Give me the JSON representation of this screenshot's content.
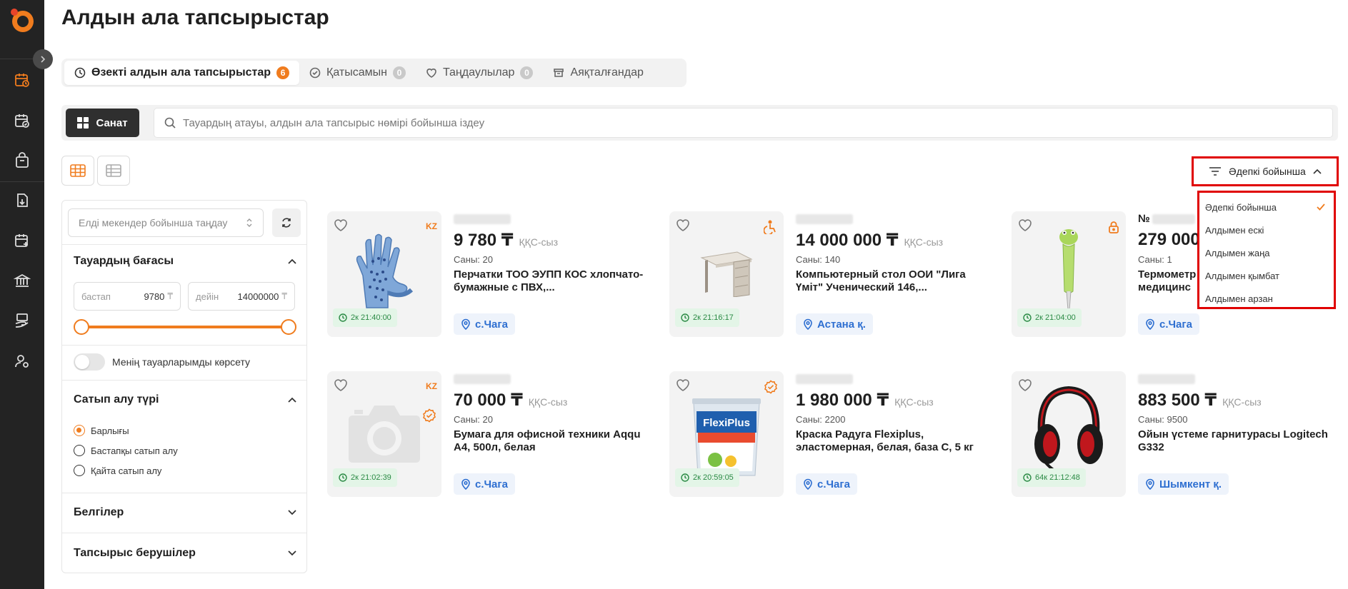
{
  "colors": {
    "accent": "#f07c1e",
    "sidebar": "#232323",
    "highlight": "#e00000",
    "timer_bg": "#e3f5e7",
    "location": "#2e6fd1"
  },
  "sidebar": {
    "icons": [
      "calendar-clock-icon",
      "calendar-check-icon",
      "shopping-bag-icon",
      "document-download-icon",
      "calendar-plus-icon",
      "bank-icon",
      "hand-cash-icon",
      "user-settings-icon"
    ]
  },
  "header": {
    "title": "Алдын ала тапсырыстар"
  },
  "tabs": [
    {
      "label": "Өзекті алдын ала тапсырыстар",
      "count": "6",
      "icon": "clock-icon"
    },
    {
      "label": "Қатысамын",
      "count": "0",
      "icon": "check-circle-icon"
    },
    {
      "label": "Таңдаулылар",
      "count": "0",
      "icon": "heart-icon"
    },
    {
      "label": "Аяқталғандар",
      "icon": "archive-icon"
    }
  ],
  "search": {
    "category_label": "Санат",
    "placeholder": "Тауардың атауы, алдын ала тапсырыс нөмірі бойынша іздеу"
  },
  "sort": {
    "selected": "Әдепкі бойынша",
    "options": [
      "Әдепкі бойынша",
      "Алдымен ескі",
      "Алдымен жаңа",
      "Алдымен қымбат",
      "Алдымен арзан"
    ]
  },
  "filters": {
    "location_placeholder": "Елді мекендер бойынша таңдау",
    "price": {
      "title": "Тауардың бағасы",
      "from_label": "бастап",
      "from_value": "9780",
      "to_label": "дейін",
      "to_value": "14000000",
      "currency": "₸"
    },
    "my_goods_label": "Менің тауарларымды көрсету",
    "purchase_type": {
      "title": "Сатып алу түрі",
      "options": [
        "Барлығы",
        "Бастапқы сатып алу",
        "Қайта сатып алу"
      ],
      "selected": 0
    },
    "tags_title": "Белгілер",
    "customers_title": "Тапсырыс берушілер"
  },
  "products": [
    {
      "id_prefix": "",
      "price": "9 780 ₸",
      "vat": "ҚҚС-сыз",
      "qty": "Саны: 20",
      "title": "Перчатки ТОО ЭУПП КОС хлопчато-бумажные с ПВХ,...",
      "timer": "2к 21:40:00",
      "location": "с.Чага",
      "badge": "KZ",
      "image": "gloves"
    },
    {
      "id_prefix": "",
      "price": "14 000 000 ₸",
      "vat": "ҚҚС-сыз",
      "qty": "Саны: 140",
      "title": "Компьютерный стол ООИ \"Лига Үміт\" Ученический 146,...",
      "timer": "2к 21:16:17",
      "location": "Астана қ.",
      "badge": "accessibility",
      "image": "desk"
    },
    {
      "id_prefix": "№",
      "price": "279 000",
      "vat": "",
      "qty": "Саны: 1",
      "title": "Термометр медицинс",
      "timer": "2к 21:04:00",
      "location": "с.Чага",
      "badge": "lock",
      "image": "thermometer"
    },
    {
      "id_prefix": "",
      "price": "70 000 ₸",
      "vat": "ҚҚС-сыз",
      "qty": "Саны: 20",
      "title": "Бумага для офисной техники Aqqu A4, 500л, белая",
      "timer": "2к 21:02:39",
      "location": "с.Чага",
      "badge": "KZ",
      "image": "camera"
    },
    {
      "id_prefix": "",
      "price": "1 980 000 ₸",
      "vat": "ҚҚС-сыз",
      "qty": "Саны: 2200",
      "title": "Краска Радуга Flexiplus, эластомерная, белая, база С, 5 кг",
      "timer": "2к 20:59:05",
      "location": "с.Чага",
      "badge": "verified",
      "image": "paint",
      "image_text": "FlexiPlus"
    },
    {
      "id_prefix": "",
      "price": "883 500 ₸",
      "vat": "ҚҚС-сыз",
      "qty": "Саны: 9500",
      "title": "Ойын үстеме гарнитурасы Logitech G332",
      "timer": "64к 21:12:48",
      "location": "Шымкент қ.",
      "badge": "",
      "image": "headset"
    }
  ]
}
